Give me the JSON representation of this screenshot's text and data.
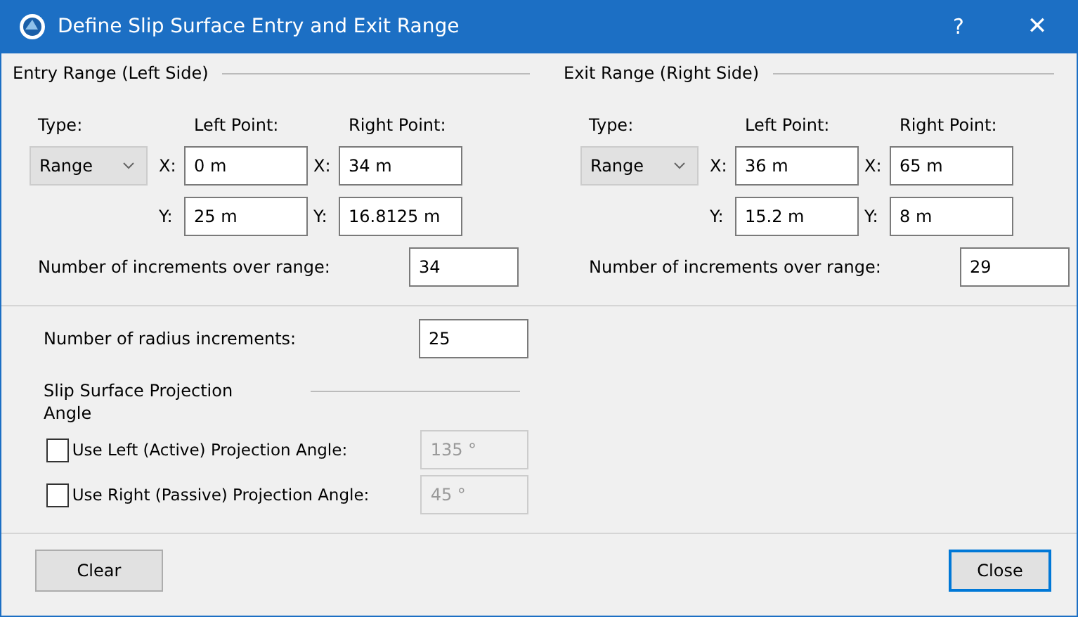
{
  "window": {
    "title": "Define Slip Surface Entry and Exit Range",
    "help": "?",
    "close": "✕"
  },
  "ranges": [
    {
      "title": "Entry Range (Left Side)",
      "type_label": "Type:",
      "type_value": "Range",
      "left_label": "Left Point:",
      "right_label": "Right Point:",
      "left_x_label": "X:",
      "left_x": "0 m",
      "right_x_label": "X:",
      "right_x": "34 m",
      "left_y_label": "Y:",
      "left_y": "25 m",
      "right_y_label": "Y:",
      "right_y": "16.8125 m",
      "increments_label": "Number of increments over range:",
      "increments": "34"
    },
    {
      "title": "Exit Range (Right Side)",
      "type_label": "Type:",
      "type_value": "Range",
      "left_label": "Left Point:",
      "right_label": "Right Point:",
      "left_x_label": "X:",
      "left_x": "36 m",
      "right_x_label": "X:",
      "right_x": "65 m",
      "left_y_label": "Y:",
      "left_y": "15.2 m",
      "right_y_label": "Y:",
      "right_y": "8 m",
      "increments_label": "Number of increments over range:",
      "increments": "29"
    }
  ],
  "radius": {
    "label": "Number of radius increments:",
    "value": "25"
  },
  "projection": {
    "title": "Slip Surface Projection Angle",
    "options": [
      {
        "label": "Use Left (Active) Projection Angle:",
        "checked": false,
        "value": "135 °"
      },
      {
        "label": "Use Right (Passive) Projection Angle:",
        "checked": false,
        "value": "45 °"
      }
    ]
  },
  "buttons": [
    {
      "label": "Clear"
    },
    {
      "label": "Close",
      "default": true
    }
  ]
}
